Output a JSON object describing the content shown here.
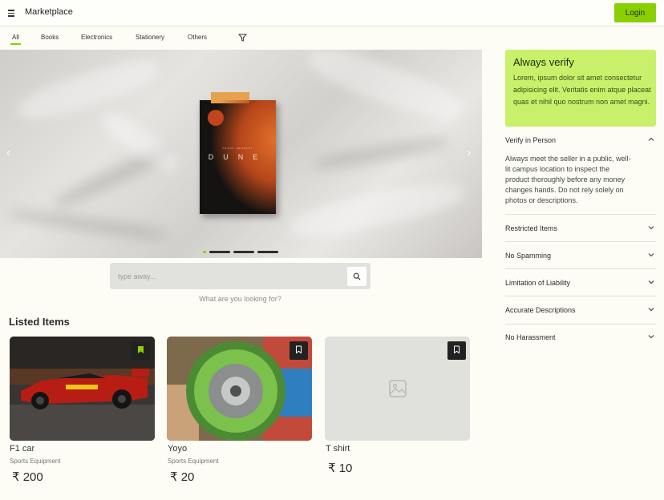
{
  "header": {
    "title": "Marketplace",
    "login_label": "Login",
    "menu_icon": "hamburger-menu-icon"
  },
  "tabs": [
    {
      "label": "All",
      "active": true
    },
    {
      "label": "Books",
      "active": false
    },
    {
      "label": "Electronics",
      "active": false
    },
    {
      "label": "Stationery",
      "active": false
    },
    {
      "label": "Others",
      "active": false
    }
  ],
  "filter_icon": "filter-funnel-icon",
  "carousel": {
    "slide_count": 4,
    "active_slide": 1,
    "slide_image": "book cover photo on bed sheet",
    "book_author": "FRANK HERBERT",
    "book_title": "DUNE"
  },
  "search": {
    "placeholder": "type away...",
    "value": "",
    "hint": "What are you looking for?"
  },
  "listed": {
    "title": "Listed Items",
    "items": [
      {
        "name": "F1 car",
        "category": "Sports Equipment",
        "price": "₹ 200",
        "bookmarked": true,
        "image": "red race car photo"
      },
      {
        "name": "Yoyo",
        "category": "Sports Equipment",
        "price": "₹ 20",
        "bookmarked": false,
        "image": "green yoyo in hand photo"
      },
      {
        "name": "T shirt",
        "category": "",
        "price": "₹ 10",
        "bookmarked": false,
        "image": "image placeholder"
      }
    ]
  },
  "sidebar": {
    "verify": {
      "title": "Always verify",
      "body": "Lorem, ipsum dolor sit amet consectetur adipisicing elit. Veritatis enim atque placeat quas et nihil quo nostrum non amet magni."
    },
    "accordion": [
      {
        "label": "Verify in Person",
        "expanded": true,
        "body": "Always meet the seller in a public, well-lit campus location to inspect the product thoroughly before any money changes hands. Do not rely solely on photos or descriptions."
      },
      {
        "label": "Restricted Items",
        "expanded": false
      },
      {
        "label": "No Spamming",
        "expanded": false
      },
      {
        "label": "Limitation of Liability",
        "expanded": false
      },
      {
        "label": "Accurate Descriptions",
        "expanded": false
      },
      {
        "label": "No Harassment",
        "expanded": false
      }
    ]
  },
  "colors": {
    "accent": "#8ad000",
    "verify_bg": "#c8f06b",
    "page_bg": "#fdfdf6",
    "bookmark_active": "#8ad000"
  }
}
